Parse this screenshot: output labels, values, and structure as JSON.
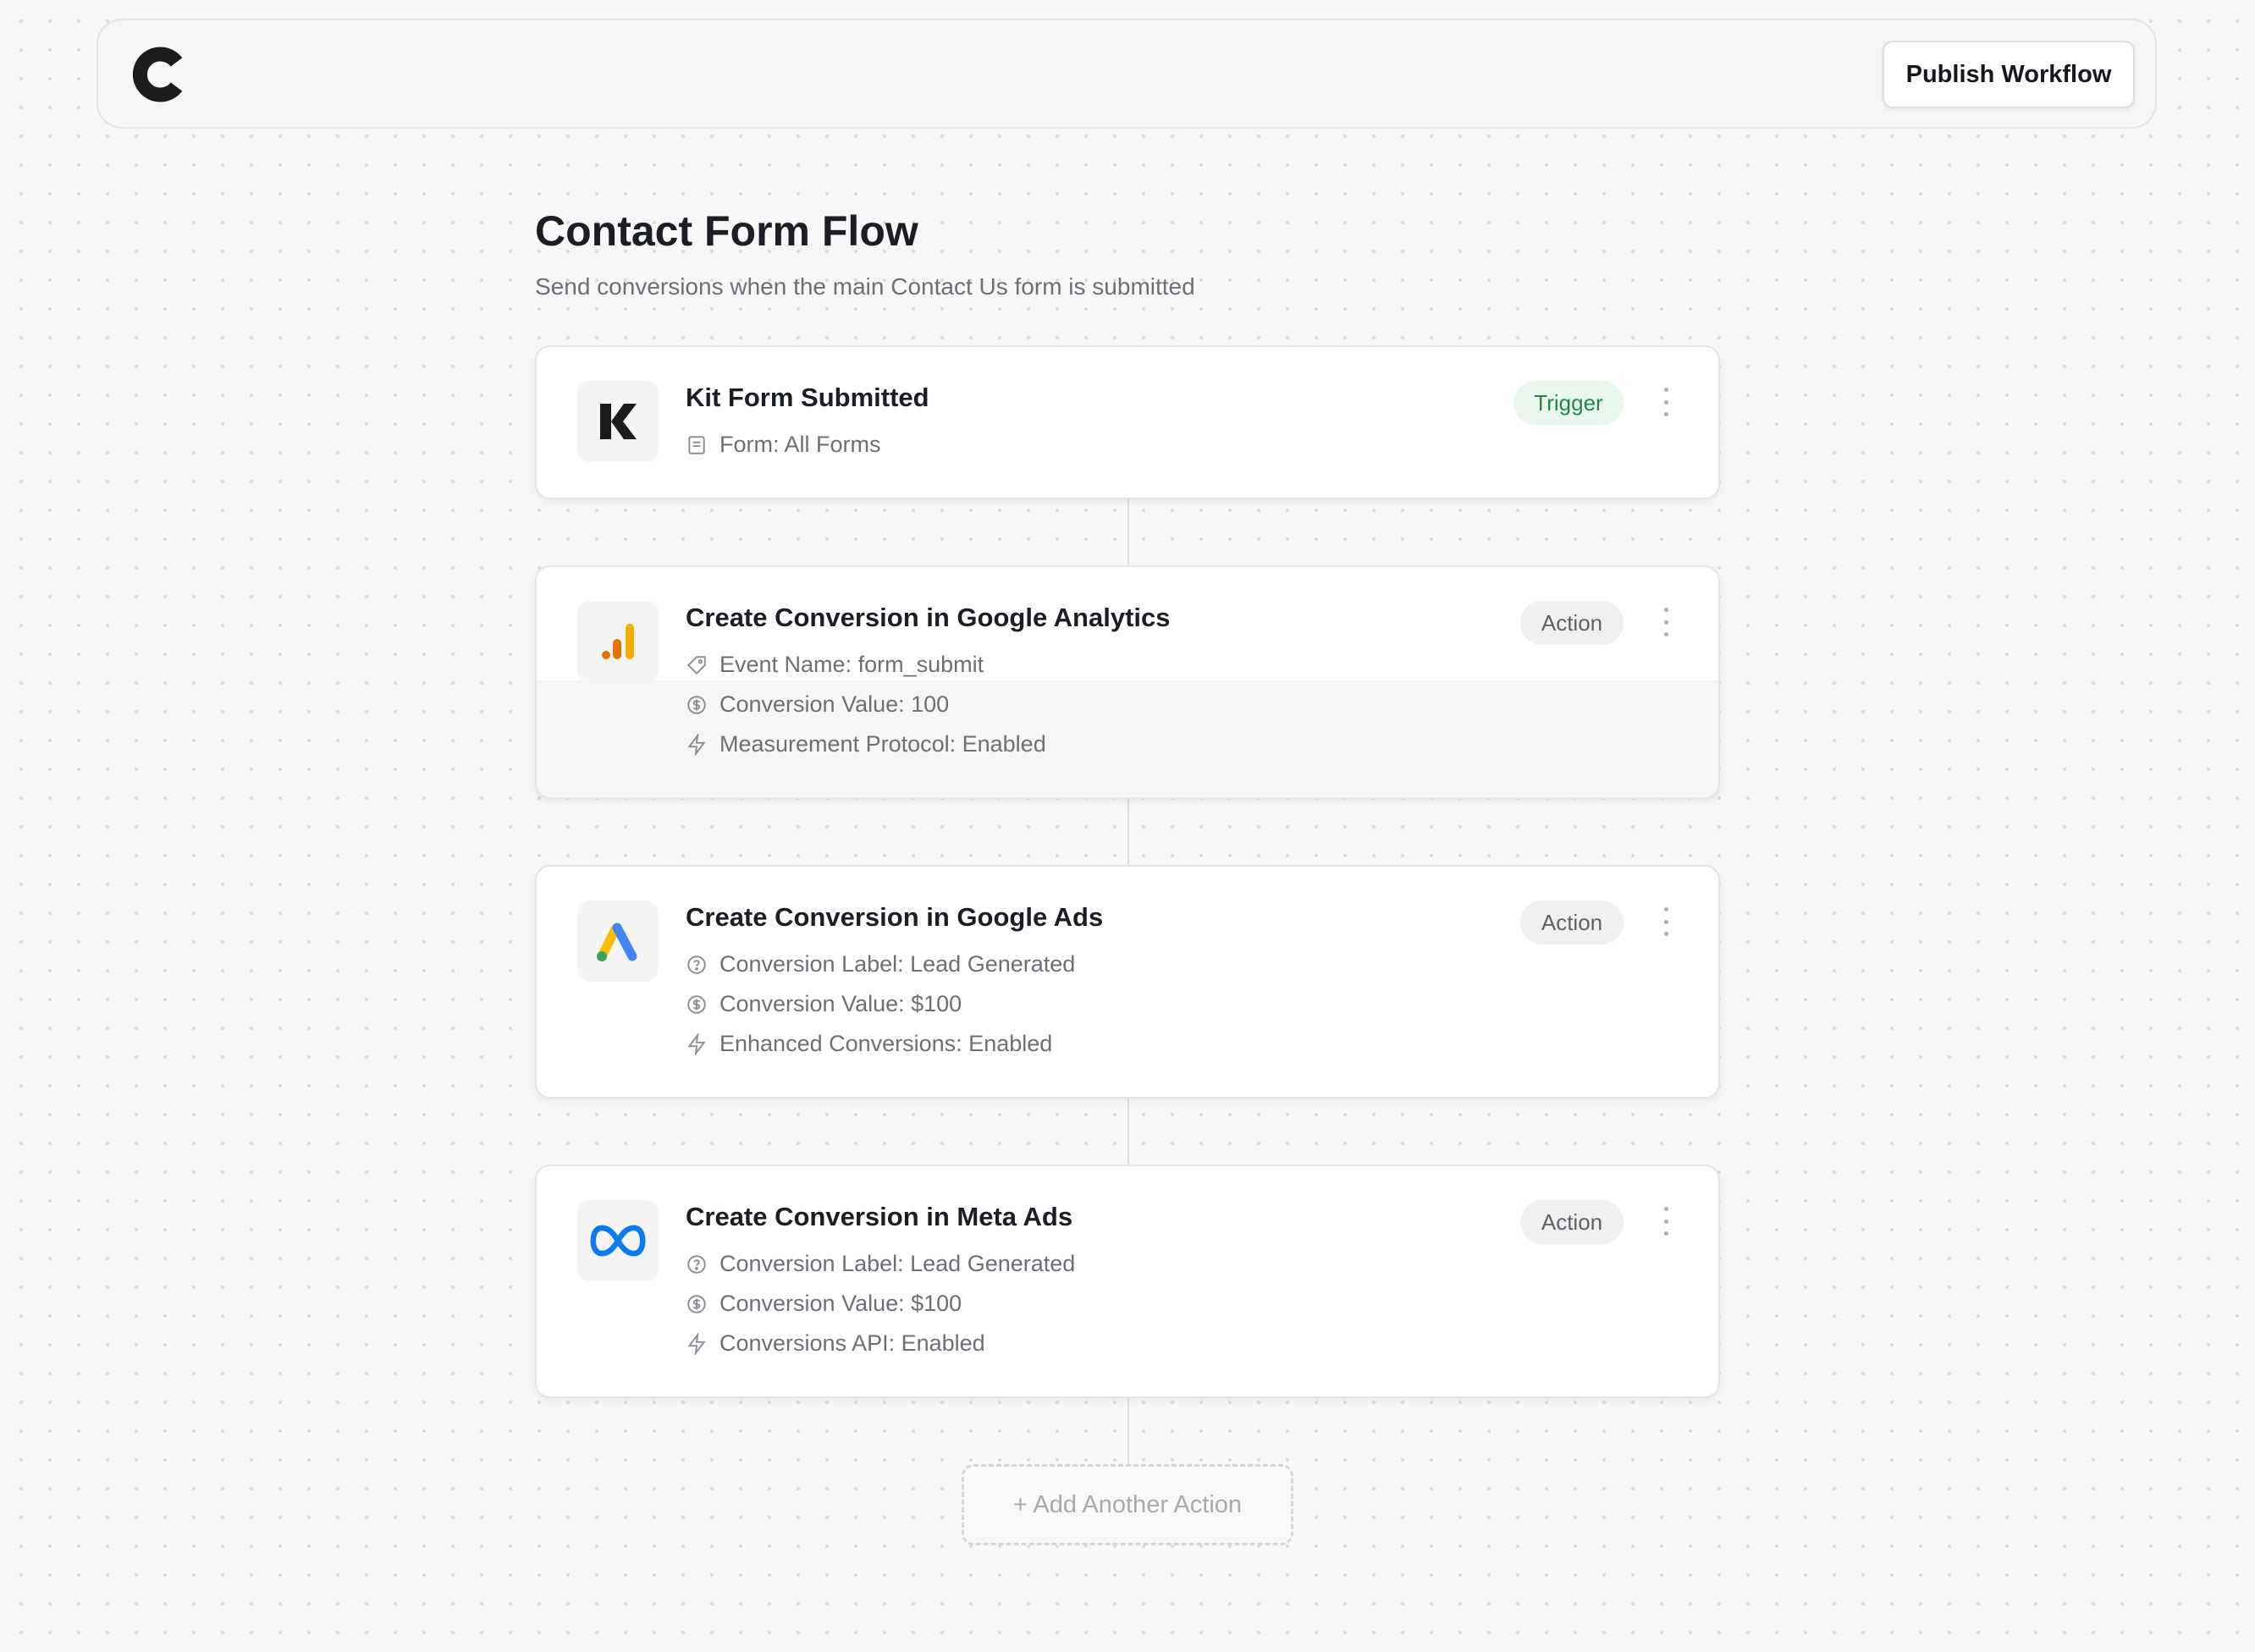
{
  "header": {
    "logo_icon": "brand-c-logo-icon",
    "publish_label": "Publish Workflow"
  },
  "flow": {
    "title": "Contact Form Flow",
    "subtitle": "Send conversions when the main Contact Us form is submitted"
  },
  "steps": [
    {
      "title": "Kit Form Submitted",
      "badge": "Trigger",
      "icon": "kit-logo-icon",
      "details": [
        {
          "icon": "form-icon",
          "text": "Form: All Forms"
        }
      ]
    },
    {
      "title": "Create Conversion in Google Analytics",
      "badge": "Action",
      "icon": "google-analytics-icon",
      "details": [
        {
          "icon": "tag-icon",
          "text": "Event Name: form_submit"
        },
        {
          "icon": "dollar-circle-icon",
          "text": "Conversion Value: 100"
        },
        {
          "icon": "lightning-icon",
          "text": "Measurement Protocol: Enabled"
        }
      ]
    },
    {
      "title": "Create Conversion in Google Ads",
      "badge": "Action",
      "icon": "google-ads-icon",
      "details": [
        {
          "icon": "help-circle-icon",
          "text": "Conversion Label: Lead Generated"
        },
        {
          "icon": "dollar-circle-icon",
          "text": "Conversion Value: $100"
        },
        {
          "icon": "lightning-icon",
          "text": "Enhanced Conversions: Enabled"
        }
      ]
    },
    {
      "title": "Create Conversion in Meta Ads",
      "badge": "Action",
      "icon": "meta-logo-icon",
      "details": [
        {
          "icon": "help-circle-icon",
          "text": "Conversion Label: Lead Generated"
        },
        {
          "icon": "dollar-circle-icon",
          "text": "Conversion Value: $100"
        },
        {
          "icon": "lightning-icon",
          "text": "Conversions API: Enabled"
        }
      ]
    }
  ],
  "add_action_label": "+ Add Another Action",
  "colors": {
    "trigger_badge_bg": "#e9f7ee",
    "trigger_badge_text": "#1f8a47",
    "action_badge_bg": "#f0f0f0",
    "action_badge_text": "#5e6168",
    "meta_blue": "#0a7cf0",
    "ga_orange": "#f9ab00",
    "ga_dark_orange": "#e37400",
    "ads_blue": "#4285f4",
    "ads_yellow": "#fbbc04",
    "ads_green": "#34a853"
  }
}
